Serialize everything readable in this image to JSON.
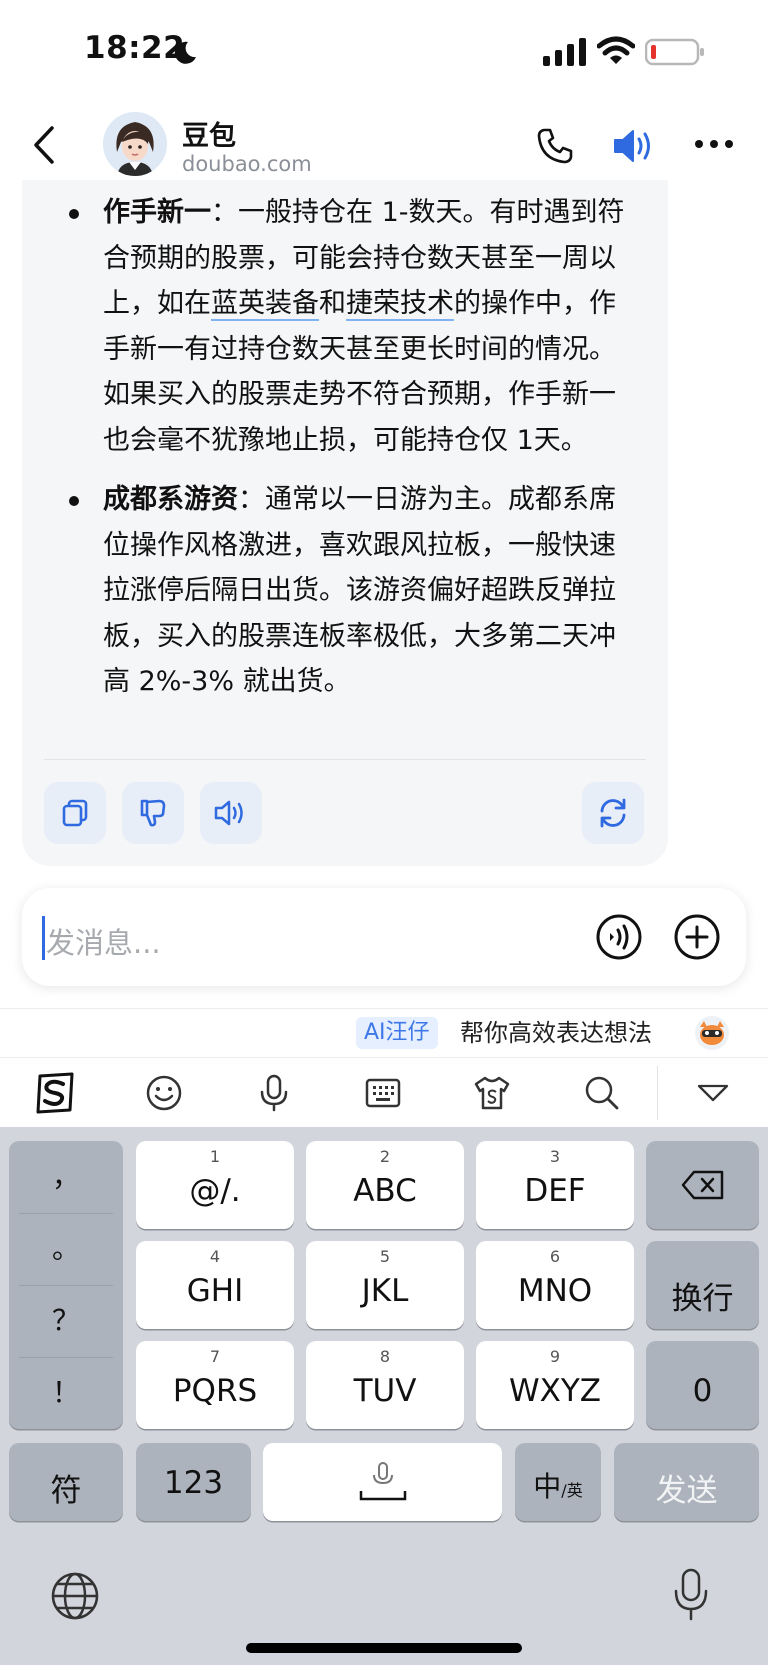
{
  "status_bar": {
    "time": "18:22"
  },
  "header": {
    "name": "豆包",
    "domain": "doubao.com"
  },
  "message": {
    "item1": {
      "title": "作手新一",
      "text_a": "：一般持仓在 1-数天。有时遇到符合预期的股票，可能会持仓数天甚至一周以上，如在",
      "link1": "蓝英装备",
      "text_b": "和",
      "link2": "捷荣技术",
      "text_c": "的操作中，作手新一有过持仓数天甚至更长时间的情况。如果买入的股票走势不符合预期，作手新一也会毫不犹豫地止损，可能持仓仅 1天。"
    },
    "item2": {
      "title": "成都系游资",
      "text": "：通常以一日游为主。成都系席位操作风格激进，喜欢跟风拉板，一般快速拉涨停后隔日出货。该游资偏好超跌反弹拉板，买入的股票连板率极低，大多第二天冲高 2%-3% 就出货。"
    }
  },
  "input": {
    "placeholder": "发消息..."
  },
  "ime": {
    "ai_badge": "AI汪仔",
    "ai_text": "帮你高效表达想法"
  },
  "keyboard": {
    "punct": [
      "，",
      "。",
      "？",
      "！"
    ],
    "keys": [
      {
        "num": "1",
        "label": "@/."
      },
      {
        "num": "2",
        "label": "ABC"
      },
      {
        "num": "3",
        "label": "DEF"
      },
      {
        "num": "4",
        "label": "GHI"
      },
      {
        "num": "5",
        "label": "JKL"
      },
      {
        "num": "6",
        "label": "MNO"
      },
      {
        "num": "7",
        "label": "PQRS"
      },
      {
        "num": "8",
        "label": "TUV"
      },
      {
        "num": "9",
        "label": "WXYZ"
      }
    ],
    "enter": "换行",
    "zero": "0",
    "symbol": "符",
    "numbers": "123",
    "lang_main": "中",
    "lang_sub": "/英",
    "send": "发送"
  },
  "colors": {
    "accent": "#2f6ae0",
    "link_underline": "#7fb3f0",
    "keyboard_bg": "#d2d5db"
  },
  "icons": [
    "moon-icon",
    "signal-icon",
    "wifi-icon",
    "battery-icon",
    "back-icon",
    "phone-icon",
    "speaker-icon",
    "more-icon",
    "copy-icon",
    "dislike-icon",
    "read-aloud-icon",
    "regenerate-icon",
    "voice-input-icon",
    "plus-icon",
    "sogou-logo-icon",
    "emoji-icon",
    "mic-icon",
    "keyboard-icon",
    "skin-icon",
    "search-icon",
    "collapse-icon",
    "backspace-icon",
    "space-mic-icon",
    "globe-icon",
    "dictation-icon"
  ]
}
